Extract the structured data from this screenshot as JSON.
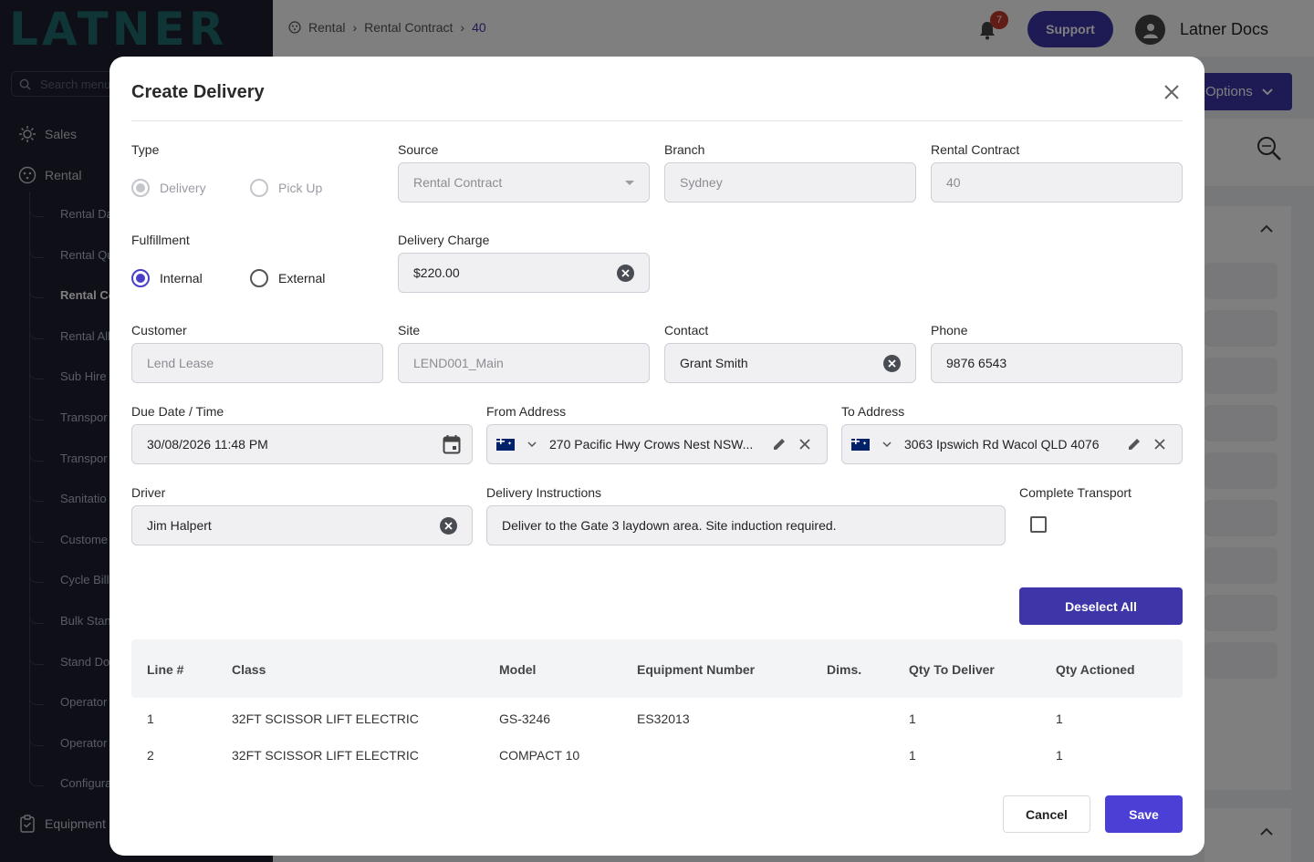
{
  "app": {
    "logo": "LATNER",
    "search_placeholder": "Search menu",
    "nav": {
      "sales": "Sales",
      "rental": "Rental",
      "equipment": "Equipment",
      "sub_items": [
        "Rental Da",
        "Rental Qu",
        "Rental Co",
        "Rental All",
        "Sub Hire",
        "Transpor",
        "Transpor",
        "Sanitatio",
        "Custome",
        "Cycle Bill",
        "Bulk Stan",
        "Stand Do",
        "Operator",
        "Operator",
        "Configura"
      ]
    },
    "breadcrumb": [
      "Rental",
      "Rental Contract",
      "40"
    ],
    "notification_count": "7",
    "support_label": "Support",
    "user_name": "Latner Docs",
    "options_label": "Options"
  },
  "modal": {
    "title": "Create Delivery",
    "type": {
      "label": "Type",
      "options": [
        "Delivery",
        "Pick Up"
      ],
      "selected": "Delivery"
    },
    "source": {
      "label": "Source",
      "value": "Rental Contract"
    },
    "branch": {
      "label": "Branch",
      "value": "Sydney"
    },
    "rental_contract": {
      "label": "Rental Contract",
      "value": "40"
    },
    "fulfillment": {
      "label": "Fulfillment",
      "options": [
        "Internal",
        "External"
      ],
      "selected": "Internal"
    },
    "delivery_charge": {
      "label": "Delivery Charge",
      "value": "$220.00"
    },
    "customer": {
      "label": "Customer",
      "value": "Lend Lease"
    },
    "site": {
      "label": "Site",
      "value": "LEND001_Main"
    },
    "contact": {
      "label": "Contact",
      "value": "Grant Smith"
    },
    "phone": {
      "label": "Phone",
      "value": "9876 6543"
    },
    "due_date": {
      "label": "Due Date / Time",
      "value": "30/08/2026 11:48 PM"
    },
    "from_address": {
      "label": "From Address",
      "value": "270 Pacific Hwy Crows Nest NSW..."
    },
    "to_address": {
      "label": "To Address",
      "value": "3063 Ipswich Rd Wacol QLD 4076"
    },
    "driver": {
      "label": "Driver",
      "value": "Jim Halpert"
    },
    "delivery_instructions": {
      "label": "Delivery Instructions",
      "value": "Deliver to the Gate 3 laydown area. Site induction required."
    },
    "complete_transport": {
      "label": "Complete Transport",
      "checked": false
    },
    "deselect_all_label": "Deselect All",
    "table": {
      "headers": [
        "Line #",
        "Class",
        "Model",
        "Equipment Number",
        "Dims.",
        "Qty To Deliver",
        "Qty Actioned"
      ],
      "rows": [
        [
          "1",
          "32FT SCISSOR LIFT ELECTRIC",
          "GS-3246",
          "ES32013",
          "",
          "1",
          "1"
        ],
        [
          "2",
          "32FT SCISSOR LIFT ELECTRIC",
          "COMPACT 10",
          "",
          "",
          "1",
          "1"
        ]
      ]
    },
    "cancel_label": "Cancel",
    "save_label": "Save"
  },
  "colors": {
    "primary": "#3d35a8",
    "save": "#4b3fd6",
    "radio_selected": "#4a3fc8",
    "sidebar_bg": "#1c1f2e"
  }
}
